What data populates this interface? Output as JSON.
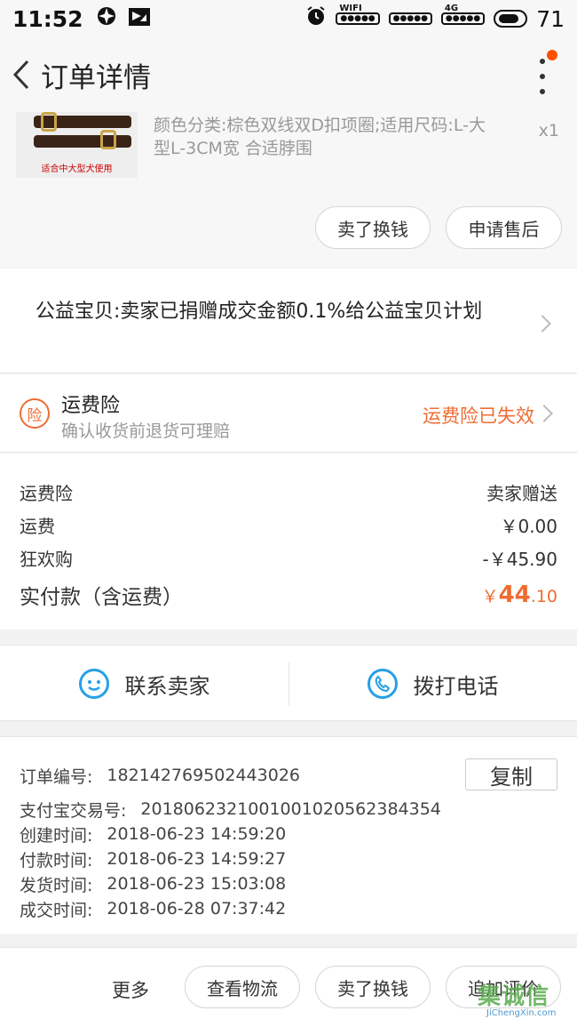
{
  "status_bar": {
    "time": "11:52",
    "wifi_label": "WIFI",
    "network_label": "4G",
    "battery": "71"
  },
  "nav": {
    "title": "订单详情"
  },
  "product": {
    "image_caption": "适合中大型犬使用",
    "sku": "颜色分类:棕色双线双D扣项圈;适用尺码:L-大型L-3CM宽 合适脖围",
    "quantity": "x1",
    "actions": [
      "卖了换钱",
      "申请售后"
    ]
  },
  "charity": {
    "text": "公益宝贝:卖家已捐赠成交金额0.1%给公益宝贝计划"
  },
  "insurance": {
    "badge": "险",
    "name": "运费险",
    "description": "确认收货前退货可理赔",
    "status": "运费险已失效"
  },
  "fees": {
    "rows": [
      {
        "label": "运费险",
        "value": "卖家赠送"
      },
      {
        "label": "运费",
        "value": "￥0.00"
      },
      {
        "label": "狂欢购",
        "value": "-￥45.90"
      }
    ],
    "total": {
      "label": "实付款（含运费）",
      "currency": "￥",
      "integer": "44",
      "decimal": ".10"
    }
  },
  "contact": {
    "seller": "联系卖家",
    "phone": "拨打电话"
  },
  "order_info": {
    "copy_label": "复制",
    "rows": [
      {
        "label": "订单编号:",
        "value": "182142769502443026"
      },
      {
        "label": "支付宝交易号:",
        "value": "2018062321001001020562384354"
      },
      {
        "label": "创建时间:",
        "value": "2018-06-23 14:59:20"
      },
      {
        "label": "付款时间:",
        "value": "2018-06-23 14:59:27"
      },
      {
        "label": "发货时间:",
        "value": "2018-06-23 15:03:08"
      },
      {
        "label": "成交时间:",
        "value": "2018-06-28 07:37:42"
      }
    ]
  },
  "bottom_bar": {
    "more": "更多",
    "buttons": [
      "查看物流",
      "卖了换钱",
      "追加评价"
    ]
  },
  "watermark": {
    "main": "集诚信",
    "sub": "JiChengXin.com"
  },
  "colors": {
    "accent": "#ef6c32",
    "link_blue": "#26a0e6",
    "badge_dot": "#ff5000"
  }
}
